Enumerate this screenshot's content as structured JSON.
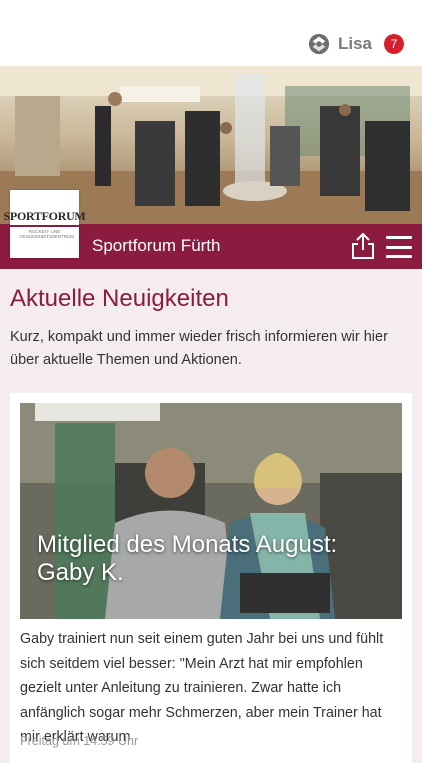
{
  "user": {
    "name": "Lisa",
    "badge": "7",
    "icon": "orbit-logo-icon"
  },
  "hero": {
    "logo_title": "SPORTFORUM",
    "logo_subtitle": "RÜCKEN- UND GESUNDHEITSZENTRUM"
  },
  "brand": {
    "title": "Sportforum Fürth",
    "share_icon": "share-icon",
    "menu_icon": "hamburger-menu-icon",
    "color": "#8b1b3f"
  },
  "section": {
    "heading": "Aktuelle Neuigkeiten",
    "intro": "Kurz, kompakt und immer wieder frisch informieren wir hier über aktuelle Themen und Aktionen."
  },
  "news": [
    {
      "title": "Mitglied des Monats August: Gaby K.",
      "excerpt": "Gaby trainiert nun seit einem guten Jahr bei uns und fühlt sich seitdem viel besser: \"Mein Arzt hat mir empfohlen gezielt unter Anleitung zu trainieren. Zwar hatte ich anfänglich sogar mehr Schmerzen, aber mein Trainer hat mir erklärt warum",
      "date": "Freitag um 14:59 Uhr"
    }
  ]
}
